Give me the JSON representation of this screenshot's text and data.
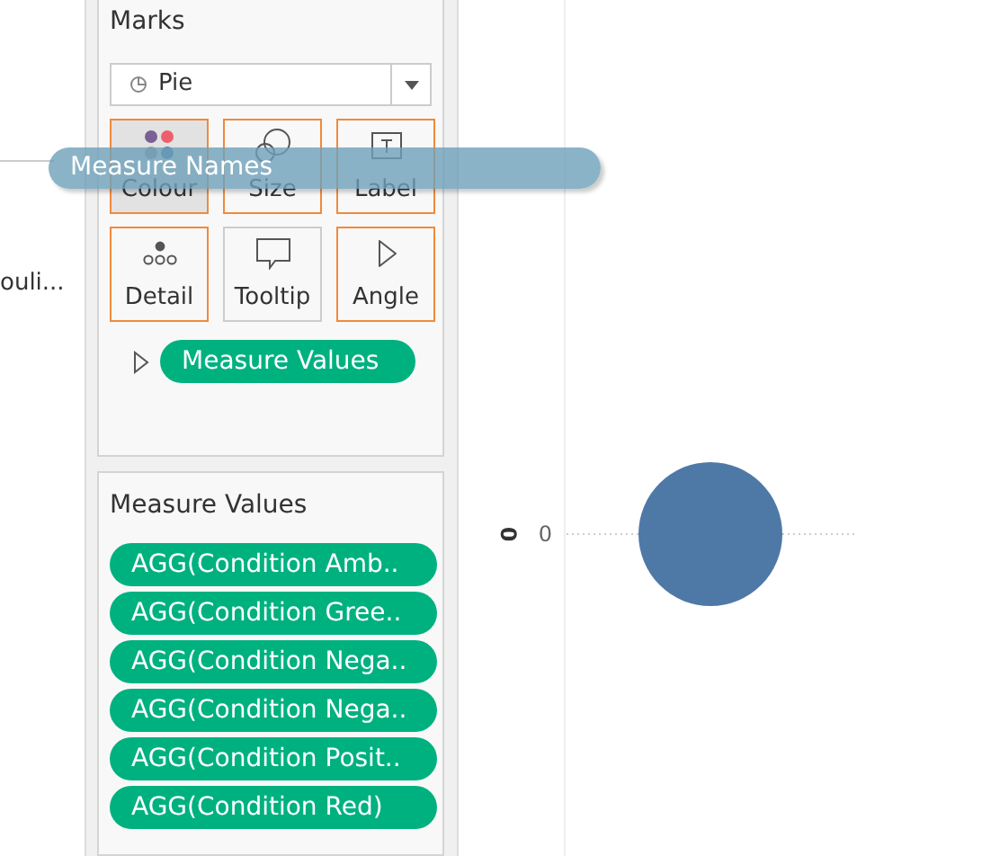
{
  "left_pane": {
    "truncated_label": "ouli..."
  },
  "marks": {
    "title": "Marks",
    "mark_type": "Pie",
    "buttons": [
      {
        "label": "Colour",
        "kind": "colour",
        "selected": true,
        "highlighted": true
      },
      {
        "label": "Size",
        "kind": "size",
        "selected": false,
        "highlighted": true
      },
      {
        "label": "Label",
        "kind": "label",
        "selected": false,
        "highlighted": true
      },
      {
        "label": "Detail",
        "kind": "detail",
        "selected": false,
        "highlighted": true
      },
      {
        "label": "Tooltip",
        "kind": "tooltip",
        "selected": false,
        "highlighted": false
      },
      {
        "label": "Angle",
        "kind": "angle",
        "selected": false,
        "highlighted": true
      }
    ],
    "fields": [
      {
        "kind": "angle",
        "label": "Measure Values"
      }
    ]
  },
  "dragged_pill": {
    "label": "Measure Names"
  },
  "measure_values": {
    "title": "Measure Values",
    "pills": [
      "AGG(Condition Amb..",
      "AGG(Condition Gree..",
      "AGG(Condition Nega..",
      "AGG(Condition Nega..",
      "AGG(Condition Posit..",
      "AGG(Condition Red)"
    ]
  },
  "view": {
    "axis_title": "0",
    "tick": "0"
  }
}
